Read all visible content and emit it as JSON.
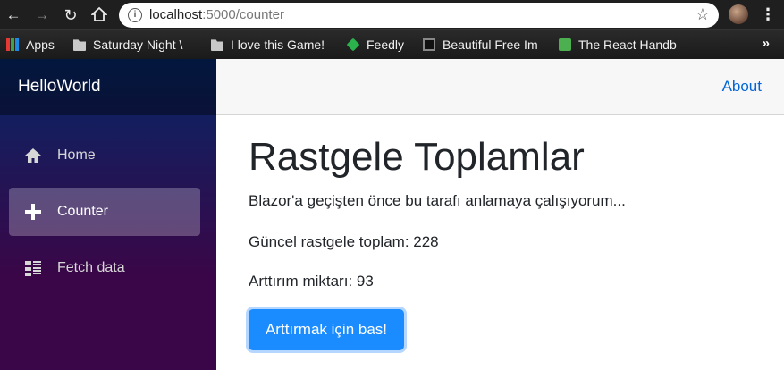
{
  "browser": {
    "url_host": "localhost",
    "url_path": ":5000/counter",
    "info_icon": "info-icon",
    "bookmarks": [
      {
        "label": "Apps",
        "icon": "apps-grid-icon"
      },
      {
        "label": "Saturday Night \\",
        "icon": "folder-icon"
      },
      {
        "label": "I love this Game!",
        "icon": "folder-icon"
      },
      {
        "label": "Feedly",
        "icon": "feedly-icon"
      },
      {
        "label": "Beautiful Free Im",
        "icon": "bookmark-icon"
      },
      {
        "label": "The React Handb",
        "icon": "bookmark-icon"
      }
    ],
    "more_label": "»"
  },
  "sidebar": {
    "brand": "HelloWorld",
    "items": [
      {
        "label": "Home",
        "icon": "home-icon"
      },
      {
        "label": "Counter",
        "icon": "plus-icon"
      },
      {
        "label": "Fetch data",
        "icon": "list-icon"
      }
    ]
  },
  "topnav": {
    "about": "About"
  },
  "main": {
    "title": "Rastgele Toplamlar",
    "subtitle": "Blazor'a geçişten önce bu tarafı anlamaya çalışıyorum...",
    "current_total_label": "Güncel rastgele toplam: 228",
    "increment_label": "Arttırım miktarı: 93",
    "button_label": "Arttırmak için bas!"
  },
  "colors": {
    "accent": "#1b8cff",
    "link": "#0366d6",
    "sidebar_top": "#052767",
    "sidebar_bottom": "#3a0647"
  }
}
